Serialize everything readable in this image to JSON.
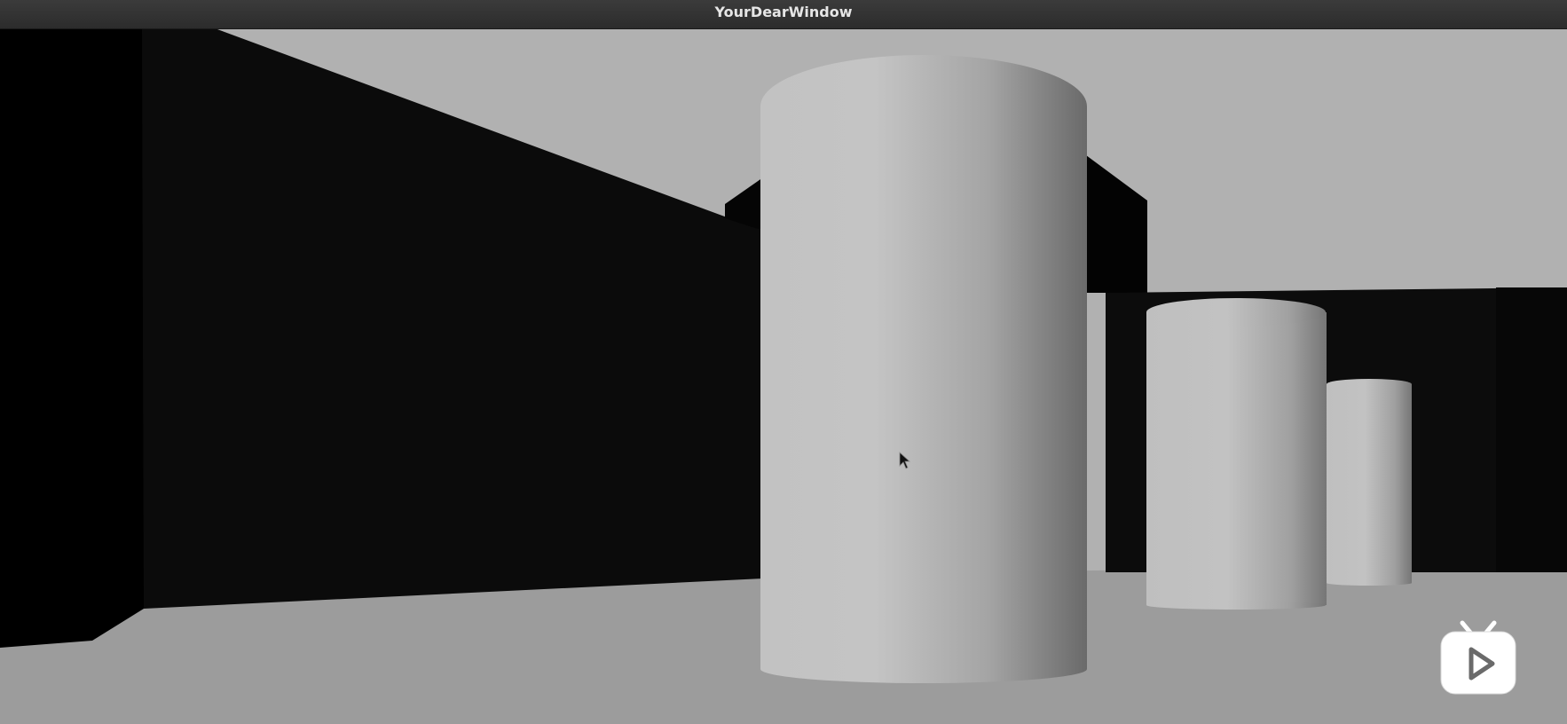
{
  "window": {
    "title": "YourDearWindow"
  },
  "scene": {
    "colors": {
      "sky": "#b1b1b1",
      "floor": "#9c9c9c",
      "wall": "#0b0b0b",
      "wall_edge": "#000000",
      "pillar_light": "#c9c9c9",
      "pillar_dark": "#6c6c6c"
    }
  },
  "watermark": {
    "icon": "bilibili-tv-play-icon"
  },
  "cursor": {
    "icon": "mouse-pointer-icon"
  }
}
